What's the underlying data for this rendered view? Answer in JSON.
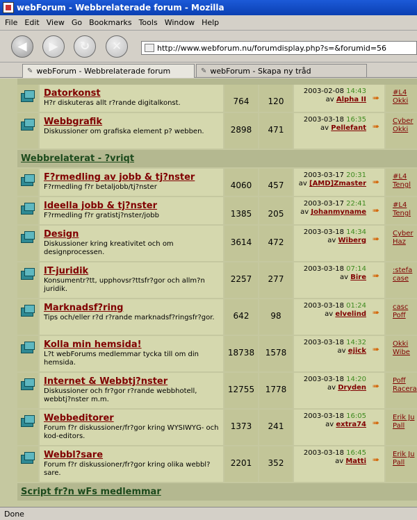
{
  "window": {
    "title": "webForum - Webbrelaterade forum - Mozilla"
  },
  "menu": [
    "File",
    "Edit",
    "View",
    "Go",
    "Bookmarks",
    "Tools",
    "Window",
    "Help"
  ],
  "url": "http://www.webforum.nu/forumdisplay.php?s=&forumid=56",
  "tabs": [
    "webForum - Webbrelaterade forum",
    "webForum - Skapa ny tråd"
  ],
  "status": "Done",
  "categories": {
    "c1": "Webbrelaterat - ?vriqt",
    "c2": "Script fr?n wFs medlemmar"
  },
  "forums": [
    {
      "name": "Datorkonst",
      "desc": "H?r diskuteras allt r?rande digitalkonst.",
      "threads": "764",
      "posts": "120",
      "date": "2003-02-08",
      "time": "14:43",
      "by": "av",
      "user": "Alpha II",
      "mods": [
        "#L4",
        "Okki"
      ]
    },
    {
      "name": "Webbgrafik",
      "desc": "Diskussioner om grafiska element p? webben.",
      "threads": "2898",
      "posts": "471",
      "date": "2003-03-18",
      "time": "16:35",
      "by": "av",
      "user": "Pellefant",
      "mods": [
        "Cyber",
        "Okki"
      ]
    },
    {
      "name": "F?rmedling av jobb & tj?nster",
      "desc": "F?rmedling f?r betaljobb/tj?nster",
      "threads": "4060",
      "posts": "457",
      "date": "2003-03-17",
      "time": "20:31",
      "by": "av",
      "user": "[AMD]Zmaster",
      "mods": [
        "#L4",
        "Tengl"
      ]
    },
    {
      "name": "Ideella jobb & tj?nster",
      "desc": "F?rmedling f?r gratistj?nster/jobb",
      "threads": "1385",
      "posts": "205",
      "date": "2003-03-17",
      "time": "22:41",
      "by": "av",
      "user": "Johanmyname",
      "mods": [
        "#L4",
        "Tengl"
      ]
    },
    {
      "name": "Design",
      "desc": "Diskussioner kring kreativitet och om designprocessen.",
      "threads": "3614",
      "posts": "472",
      "date": "2003-03-18",
      "time": "14:34",
      "by": "av",
      "user": "Wiberg",
      "mods": [
        "Cyber",
        "Haz"
      ]
    },
    {
      "name": "IT-juridik",
      "desc": "Konsumentr?tt, upphovsr?ttsfr?gor och allm?n juridik.",
      "threads": "2257",
      "posts": "277",
      "date": "2003-03-18",
      "time": "07:14",
      "by": "av",
      "user": "Bire",
      "mods": [
        ":stefa",
        "case"
      ]
    },
    {
      "name": "Marknadsf?ring",
      "desc": "Tips och/eller r?d r?rande marknadsf?ringsfr?gor.",
      "threads": "642",
      "posts": "98",
      "date": "2003-03-18",
      "time": "01:24",
      "by": "av",
      "user": "elvelind",
      "mods": [
        "casc",
        "Poff"
      ]
    },
    {
      "name": "Kolla min hemsida!",
      "desc": "L?t webForums medlemmar tycka till om din hemsida.",
      "threads": "18738",
      "posts": "1578",
      "date": "2003-03-18",
      "time": "14:32",
      "by": "av",
      "user": "ejick",
      "mods": [
        "Okki",
        "Wibe"
      ]
    },
    {
      "name": "Internet & Webbtj?nster",
      "desc": "Diskussioner och fr?gor r?rande webbhotell, webbtj?nster m.m.",
      "threads": "12755",
      "posts": "1778",
      "date": "2003-03-18",
      "time": "14:20",
      "by": "av",
      "user": "Dryden",
      "mods": [
        "Poff",
        "Racera"
      ]
    },
    {
      "name": "Webbeditorer",
      "desc": "Forum f?r diskussioner/fr?gor kring WYSIWYG- och kod-editors.",
      "threads": "1373",
      "posts": "241",
      "date": "2003-03-18",
      "time": "16:05",
      "by": "av",
      "user": "extra74",
      "mods": [
        "Erik Ju",
        "Pall"
      ]
    },
    {
      "name": "Webbl?sare",
      "desc": "Forum f?r diskussioner/fr?gor kring olika webbl?sare.",
      "threads": "2201",
      "posts": "352",
      "date": "2003-03-18",
      "time": "16:45",
      "by": "av",
      "user": "Matti",
      "mods": [
        "Erik Ju",
        "Pall"
      ]
    }
  ]
}
